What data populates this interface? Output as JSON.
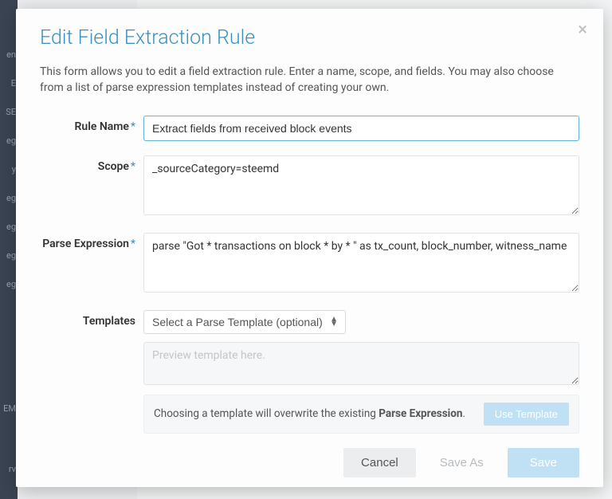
{
  "modal": {
    "title": "Edit Field Extraction Rule",
    "description": "This form allows you to edit a field extraction rule. Enter a name, scope, and fields. You may also choose from a list of parse expression templates instead of creating your own.",
    "close_glyph": "×"
  },
  "form": {
    "rule_name": {
      "label": "Rule Name",
      "required": "*",
      "value": "Extract fields from received block events"
    },
    "scope": {
      "label": "Scope",
      "required": "*",
      "value": "_sourceCategory=steemd"
    },
    "parse_expression": {
      "label": "Parse Expression",
      "required": "*",
      "value": "parse \"Got * transactions on block * by * \" as tx_count, block_number, witness_name"
    },
    "templates": {
      "label": "Templates",
      "select_placeholder": "Select a Parse Template (optional)",
      "preview_placeholder": "Preview template here.",
      "info_prefix": "Choosing a template will overwrite the existing ",
      "info_bold": "Parse Expression",
      "info_suffix": ".",
      "use_template_btn": "Use Template"
    }
  },
  "footer": {
    "cancel": "Cancel",
    "save_as": "Save As",
    "save": "Save"
  },
  "sidebar_fragments": [
    "en",
    "E",
    "SE",
    "eg",
    "y",
    "eg",
    "eg",
    "eg",
    "eg",
    "EM",
    "rv"
  ]
}
